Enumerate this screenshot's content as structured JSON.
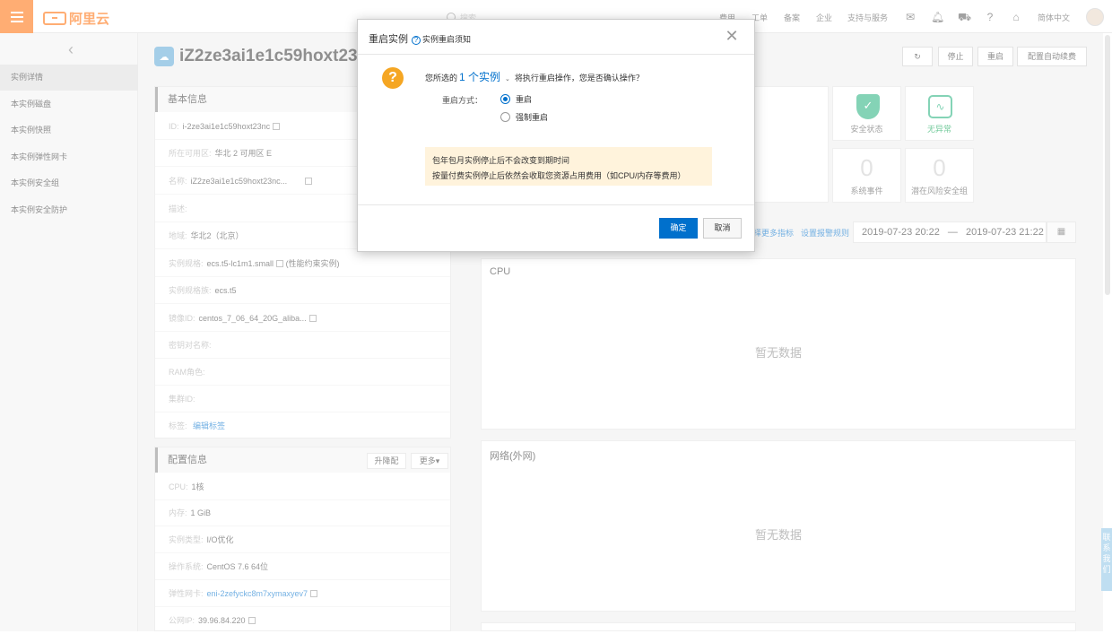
{
  "topbar": {
    "logo_text": "阿里云",
    "search_placeholder": "搜索",
    "nav": [
      "费用",
      "工单",
      "备案",
      "企业",
      "支持与服务"
    ],
    "language": "简体中文"
  },
  "sidebar": {
    "items": [
      {
        "label": "实例详情",
        "active": true
      },
      {
        "label": "本实例磁盘"
      },
      {
        "label": "本实例快照"
      },
      {
        "label": "本实例弹性网卡"
      },
      {
        "label": "本实例安全组"
      },
      {
        "label": "本实例安全防护"
      }
    ]
  },
  "header": {
    "instance_name": "iZ2ze3ai1e1c59hoxt23nc",
    "actions": [
      "停止",
      "重启",
      "配置自动续费"
    ]
  },
  "basic_info": {
    "title": "基本信息",
    "rows": [
      {
        "key": "ID:",
        "value": "i-2ze3ai1e1c59hoxt23nc"
      },
      {
        "key": "所在可用区:",
        "value": "华北 2 可用区 E"
      },
      {
        "key": "名称:",
        "value": "iZ2ze3ai1e1c59hoxt23nc..."
      },
      {
        "key": "描述:",
        "value": ""
      },
      {
        "key": "地域:",
        "value": "华北2（北京）"
      },
      {
        "key": "实例规格:",
        "value": "ecs.t5-lc1m1.small",
        "extra": "(性能约束实例)"
      },
      {
        "key": "实例规格族:",
        "value": "ecs.t5"
      },
      {
        "key": "镜像ID:",
        "value": "centos_7_06_64_20G_aliba..."
      },
      {
        "key": "密钥对名称:",
        "value": ""
      },
      {
        "key": "RAM角色:",
        "value": ""
      },
      {
        "key": "集群ID:",
        "value": ""
      },
      {
        "key": "标签:",
        "value": "编辑标签"
      }
    ]
  },
  "config_info": {
    "title": "配置信息",
    "buttons": [
      "升降配",
      "更多▾"
    ],
    "rows": [
      {
        "key": "CPU:",
        "value": "1核"
      },
      {
        "key": "内存:",
        "value": "1 GiB"
      },
      {
        "key": "实例类型:",
        "value": "I/O优化"
      },
      {
        "key": "操作系统:",
        "value": "CentOS 7.6 64位"
      },
      {
        "key": "弹性网卡:",
        "value": "eni-2zefyckc8m7xymaxyev7"
      },
      {
        "key": "公网IP:",
        "value": "39.96.84.220"
      }
    ]
  },
  "stats": {
    "security_status": "安全状态",
    "anomaly": "无异常",
    "system_events": {
      "value": "0",
      "label": "系统事件"
    },
    "risk_groups": {
      "value": "0",
      "label": "潜在风险安全组"
    }
  },
  "monitor": {
    "links": [
      "择更多指标",
      "设置报警规则"
    ],
    "date_from": "2019-07-23 20:22",
    "date_sep": "—",
    "date_to": "2019-07-23 21:22",
    "charts": [
      {
        "title": "CPU",
        "empty": "暂无数据"
      },
      {
        "title": "网络(外网)",
        "empty": "暂无数据"
      }
    ]
  },
  "side_tab": "联系我们",
  "dialog": {
    "title": "重启实例",
    "help_text": "实例重启须知",
    "confirm_prefix": "您所选的",
    "confirm_count": "1 个实例",
    "confirm_suffix": "将执行重启操作，您是否确认操作？",
    "mode_label": "重启方式：",
    "options": [
      {
        "label": "重启",
        "checked": true
      },
      {
        "label": "强制重启",
        "checked": false
      }
    ],
    "notice_lines": [
      "包年包月实例停止后不会改变到期时间",
      "按量付费实例停止后依然会收取您资源占用费用（如CPU/内存等费用）"
    ],
    "ok": "确定",
    "cancel": "取消"
  }
}
